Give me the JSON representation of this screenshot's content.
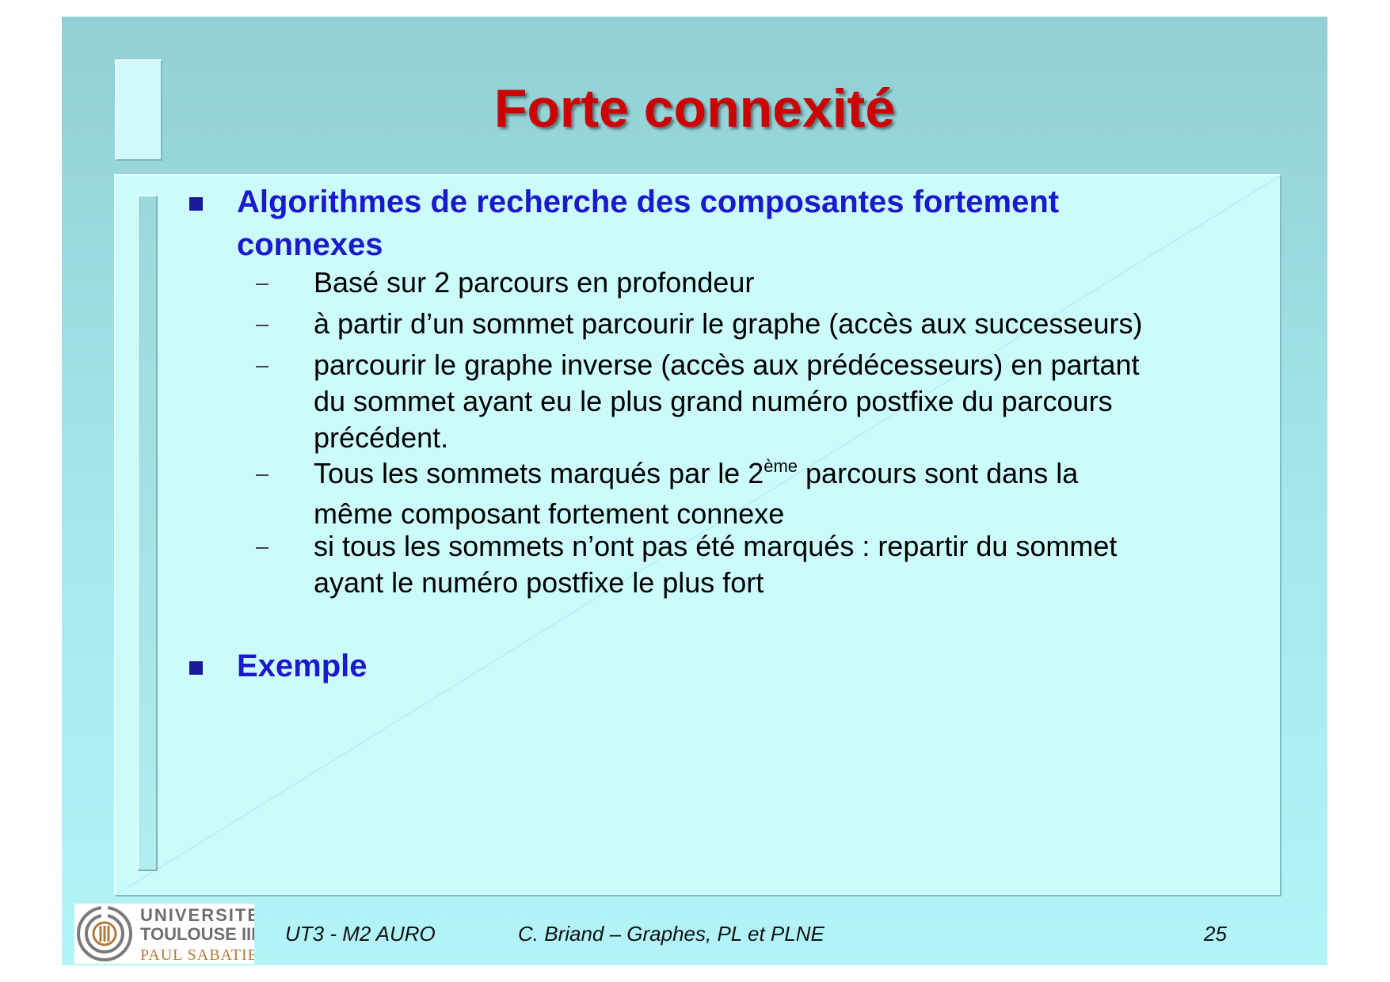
{
  "slide": {
    "title": "Forte connexité",
    "bullets": [
      {
        "text": "Algorithmes de recherche des composantes fortement connexes",
        "sub_items": [
          {
            "text": "Basé sur 2 parcours en profondeur"
          },
          {
            "text": "à partir d’un sommet  parcourir le graphe  (accès aux successeurs)"
          },
          {
            "lines": [
              "parcourir le graphe inverse  (accès aux prédécesseurs) en partant",
              "du sommet ayant eu le plus grand numéro postfixe du parcours",
              "précédent."
            ]
          },
          {
            "line1_before": "Tous les sommets marqués par le 2",
            "line1_sup": "ème",
            "line1_after": " parcours sont dans la",
            "line2": "même composant fortement connexe"
          },
          {
            "lines": [
              "si tous les sommets n’ont pas été marqués : repartir du sommet",
              "ayant le numéro postfixe le plus fort"
            ]
          }
        ]
      },
      {
        "text": "Exemple"
      }
    ]
  },
  "footer": {
    "logo": {
      "line1": "UNIVERSITE",
      "line2": "TOULOUSE III",
      "line3": "PAUL SABATIER"
    },
    "course": "UT3 - M2 AURO",
    "author": "C. Briand – Graphes, PL et PLNE",
    "page_number": "25"
  },
  "colors": {
    "title": "#cc0000",
    "bullet_text": "#1a1acc",
    "background": "#a6e8ee",
    "panel": "#ccfbfb"
  }
}
